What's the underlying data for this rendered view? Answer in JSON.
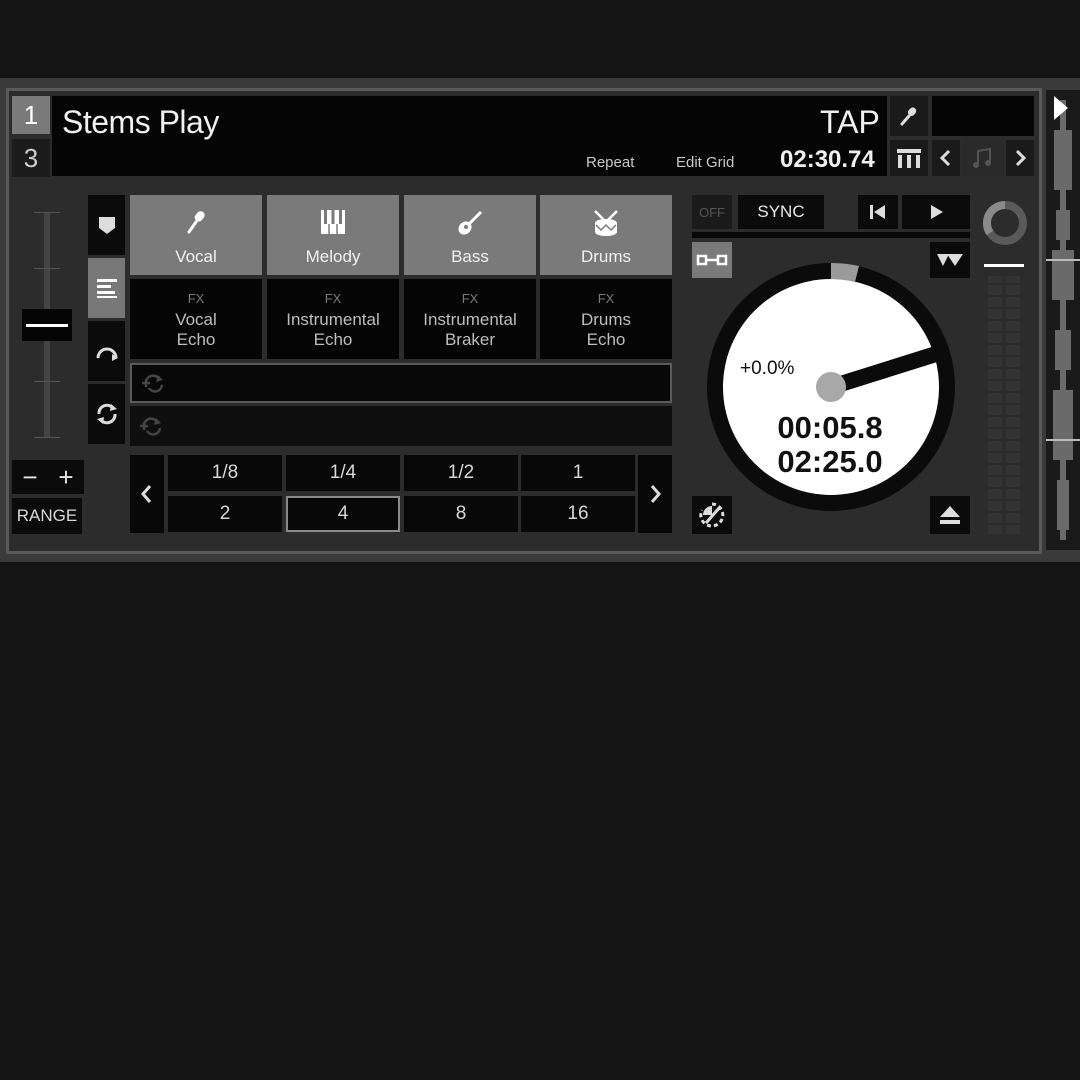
{
  "deck": {
    "numbers": [
      "1",
      "3"
    ],
    "title": "Stems Play",
    "tap_label": "TAP",
    "repeat_label": "Repeat",
    "edit_grid_label": "Edit Grid",
    "time_total": "02:30.74"
  },
  "pitch": {
    "minus_label": "−",
    "plus_label": "+",
    "range_label": "RANGE"
  },
  "stems": [
    {
      "label": "Vocal",
      "icon": "microphone-icon"
    },
    {
      "label": "Melody",
      "icon": "piano-icon"
    },
    {
      "label": "Bass",
      "icon": "guitar-icon"
    },
    {
      "label": "Drums",
      "icon": "drum-icon"
    }
  ],
  "fx": [
    {
      "tag": "FX",
      "line1": "Vocal",
      "line2": "Echo"
    },
    {
      "tag": "FX",
      "line1": "Instrumental",
      "line2": "Echo"
    },
    {
      "tag": "FX",
      "line1": "Instrumental",
      "line2": "Braker"
    },
    {
      "tag": "FX",
      "line1": "Drums",
      "line2": "Echo"
    }
  ],
  "beats": {
    "row1": [
      "1/8",
      "1/4",
      "1/2",
      "1"
    ],
    "row2": [
      "2",
      "4",
      "8",
      "16"
    ],
    "selected": "4"
  },
  "transport": {
    "off_label": "OFF",
    "sync_label": "SYNC"
  },
  "platter": {
    "pitch": "+0.0%",
    "elapsed": "00:05.8",
    "remaining": "02:25.0"
  },
  "colors": {
    "background": "#141414",
    "panel": "#2c2c2c",
    "active_button": "#7a7a7a",
    "platter": "#ffffff"
  }
}
